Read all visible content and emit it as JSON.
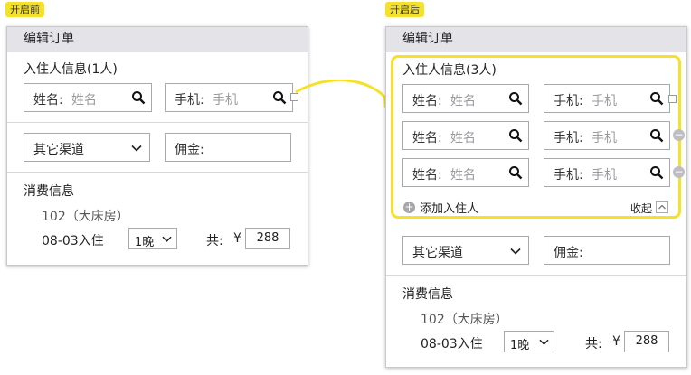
{
  "tags": {
    "before": "开启前",
    "after": "开启后"
  },
  "panel_title": "编辑订单",
  "before": {
    "guest_section_title": "入住人信息(1人)",
    "guest": {
      "name_label": "姓名:",
      "name_placeholder": "姓名",
      "phone_label": "手机:",
      "phone_placeholder": "手机"
    },
    "channel": "其它渠道",
    "commission_label": "佣金:",
    "consumption_title": "消费信息",
    "room": "102（大床房）",
    "checkin": "08-03入住",
    "nights": "1晚",
    "total_label": "共:",
    "currency": "¥",
    "price": "288"
  },
  "after": {
    "guest_section_title": "入住人信息(3人)",
    "guests": [
      {
        "name_label": "姓名:",
        "name_placeholder": "姓名",
        "phone_label": "手机:",
        "phone_placeholder": "手机"
      },
      {
        "name_label": "姓名:",
        "name_placeholder": "姓名",
        "phone_label": "手机:",
        "phone_placeholder": "手机"
      },
      {
        "name_label": "姓名:",
        "name_placeholder": "姓名",
        "phone_label": "手机:",
        "phone_placeholder": "手机"
      }
    ],
    "add_guest": "添加入住人",
    "collapse": "收起",
    "channel": "其它渠道",
    "commission_label": "佣金:",
    "consumption_title": "消费信息",
    "room": "102（大床房）",
    "checkin": "08-03入住",
    "nights": "1晚",
    "total_label": "共:",
    "currency": "¥",
    "price": "288"
  },
  "colors": {
    "highlight": "#f5e02a",
    "header_bg": "#e3e3e8"
  },
  "icons": [
    "search-icon",
    "chevron-down-icon",
    "plus-circle-icon",
    "minus-circle-icon",
    "collapse-icon",
    "arrow-connector"
  ]
}
